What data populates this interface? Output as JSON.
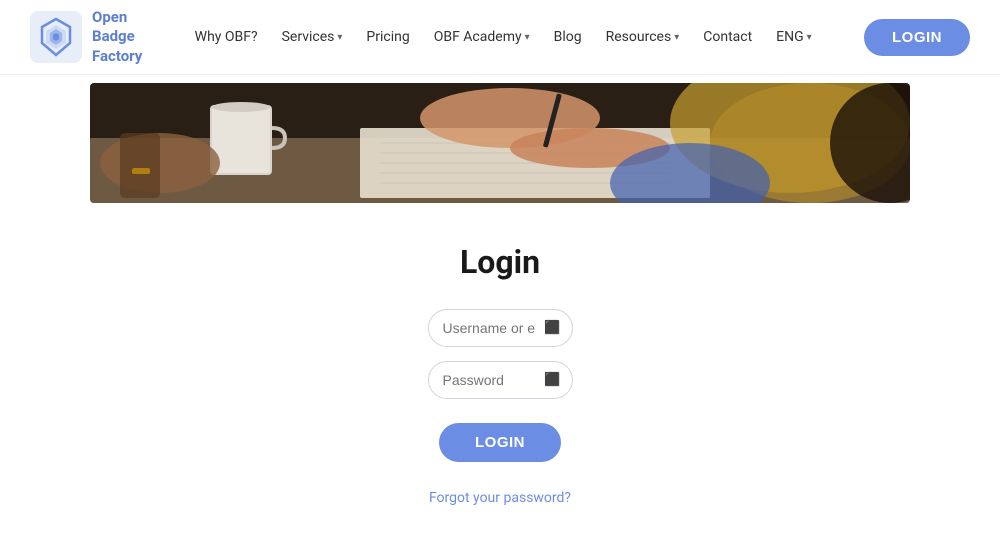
{
  "brand": {
    "name_line1": "Open",
    "name_line2": "Badge",
    "name_line3": "Factory",
    "full_name": "Open Badge Factory"
  },
  "nav": {
    "items": [
      {
        "label": "Why OBF?",
        "has_dropdown": false
      },
      {
        "label": "Services",
        "has_dropdown": true
      },
      {
        "label": "Pricing",
        "has_dropdown": false
      },
      {
        "label": "OBF Academy",
        "has_dropdown": true
      },
      {
        "label": "Blog",
        "has_dropdown": false
      },
      {
        "label": "Resources",
        "has_dropdown": true
      },
      {
        "label": "Contact",
        "has_dropdown": false
      },
      {
        "label": "ENG",
        "has_dropdown": true
      }
    ],
    "login_button": "LOGIN"
  },
  "hero": {
    "alt": "Person writing at desk with coffee mug"
  },
  "login_form": {
    "title": "Login",
    "username_placeholder": "Username or email",
    "password_placeholder": "Password",
    "submit_label": "LOGIN",
    "forgot_label": "Forgot your password?"
  },
  "colors": {
    "accent": "#6b8de3",
    "text_dark": "#1a1a1a",
    "text_muted": "#666"
  }
}
